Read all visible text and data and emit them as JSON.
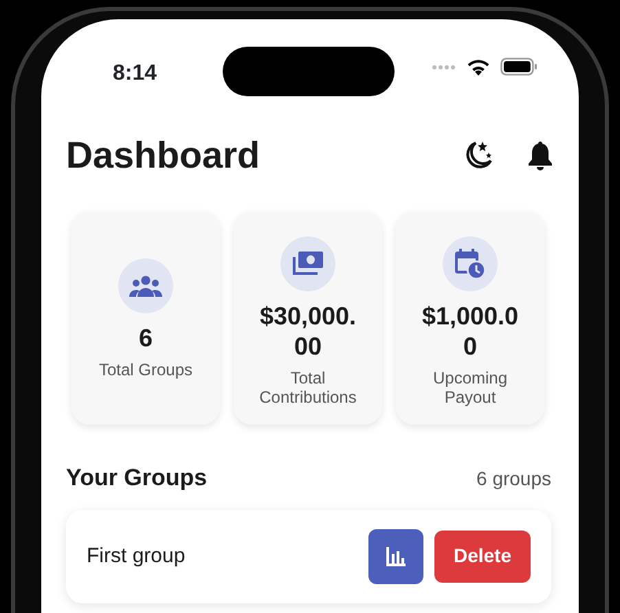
{
  "status_bar": {
    "time": "8:14"
  },
  "header": {
    "title": "Dashboard"
  },
  "stats": [
    {
      "kind": "groups",
      "value": "6",
      "label": "Total Groups"
    },
    {
      "kind": "contributions",
      "value": "$30,000.00",
      "label": "Total Contributions"
    },
    {
      "kind": "payout",
      "value": "$1,000.00",
      "label": "Upcoming Payout"
    }
  ],
  "groups_section": {
    "title": "Your Groups",
    "count": "6 groups"
  },
  "groups": [
    {
      "name": "First group",
      "delete_label": "Delete"
    }
  ]
}
